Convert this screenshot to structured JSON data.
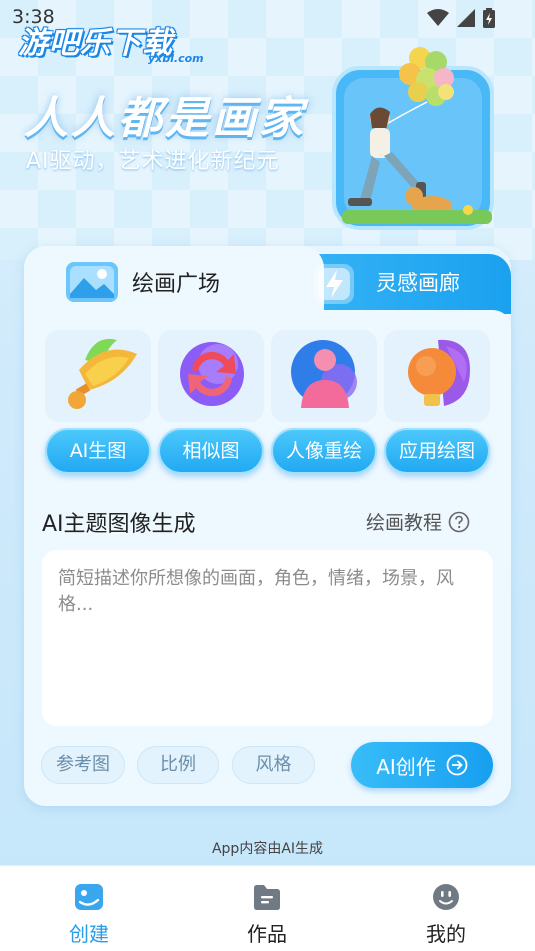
{
  "status_bar": {
    "time": "3:38",
    "icons": [
      "wifi-icon",
      "signal-icon",
      "battery-icon"
    ]
  },
  "watermark": {
    "text": "游吧乐下载",
    "sub": "yxbl.com"
  },
  "hero": {
    "title": "人人都是画家",
    "subtitle": "AI驱动，艺术进化新纪元"
  },
  "tabs": [
    {
      "label": "绘画广场",
      "icon": "picture-icon",
      "active": true
    },
    {
      "label": "灵感画廊",
      "icon": "lightning-icon",
      "active": false
    }
  ],
  "tools": [
    {
      "label": "AI生图",
      "icon": "brush-icon"
    },
    {
      "label": "相似图",
      "icon": "refresh-icon"
    },
    {
      "label": "人像重绘",
      "icon": "person-icon"
    },
    {
      "label": "应用绘图",
      "icon": "bulb-icon"
    }
  ],
  "generator": {
    "title": "AI主题图像生成",
    "tutorial": "绘画教程",
    "placeholder": "简短描述你所想像的画面，角色，情绪，场景，风格..."
  },
  "options": {
    "reference": "参考图",
    "ratio": "比例",
    "style": "风格"
  },
  "create_button": "AI创作",
  "ai_note": "App内容由AI生成",
  "nav": [
    {
      "label": "创建",
      "icon": "create-icon",
      "active": true
    },
    {
      "label": "作品",
      "icon": "works-icon",
      "active": false
    },
    {
      "label": "我的",
      "icon": "profile-icon",
      "active": false
    }
  ],
  "colors": {
    "accent": "#22a9f3",
    "nav_active": "#2a9de8",
    "card": "#eef8ff"
  }
}
